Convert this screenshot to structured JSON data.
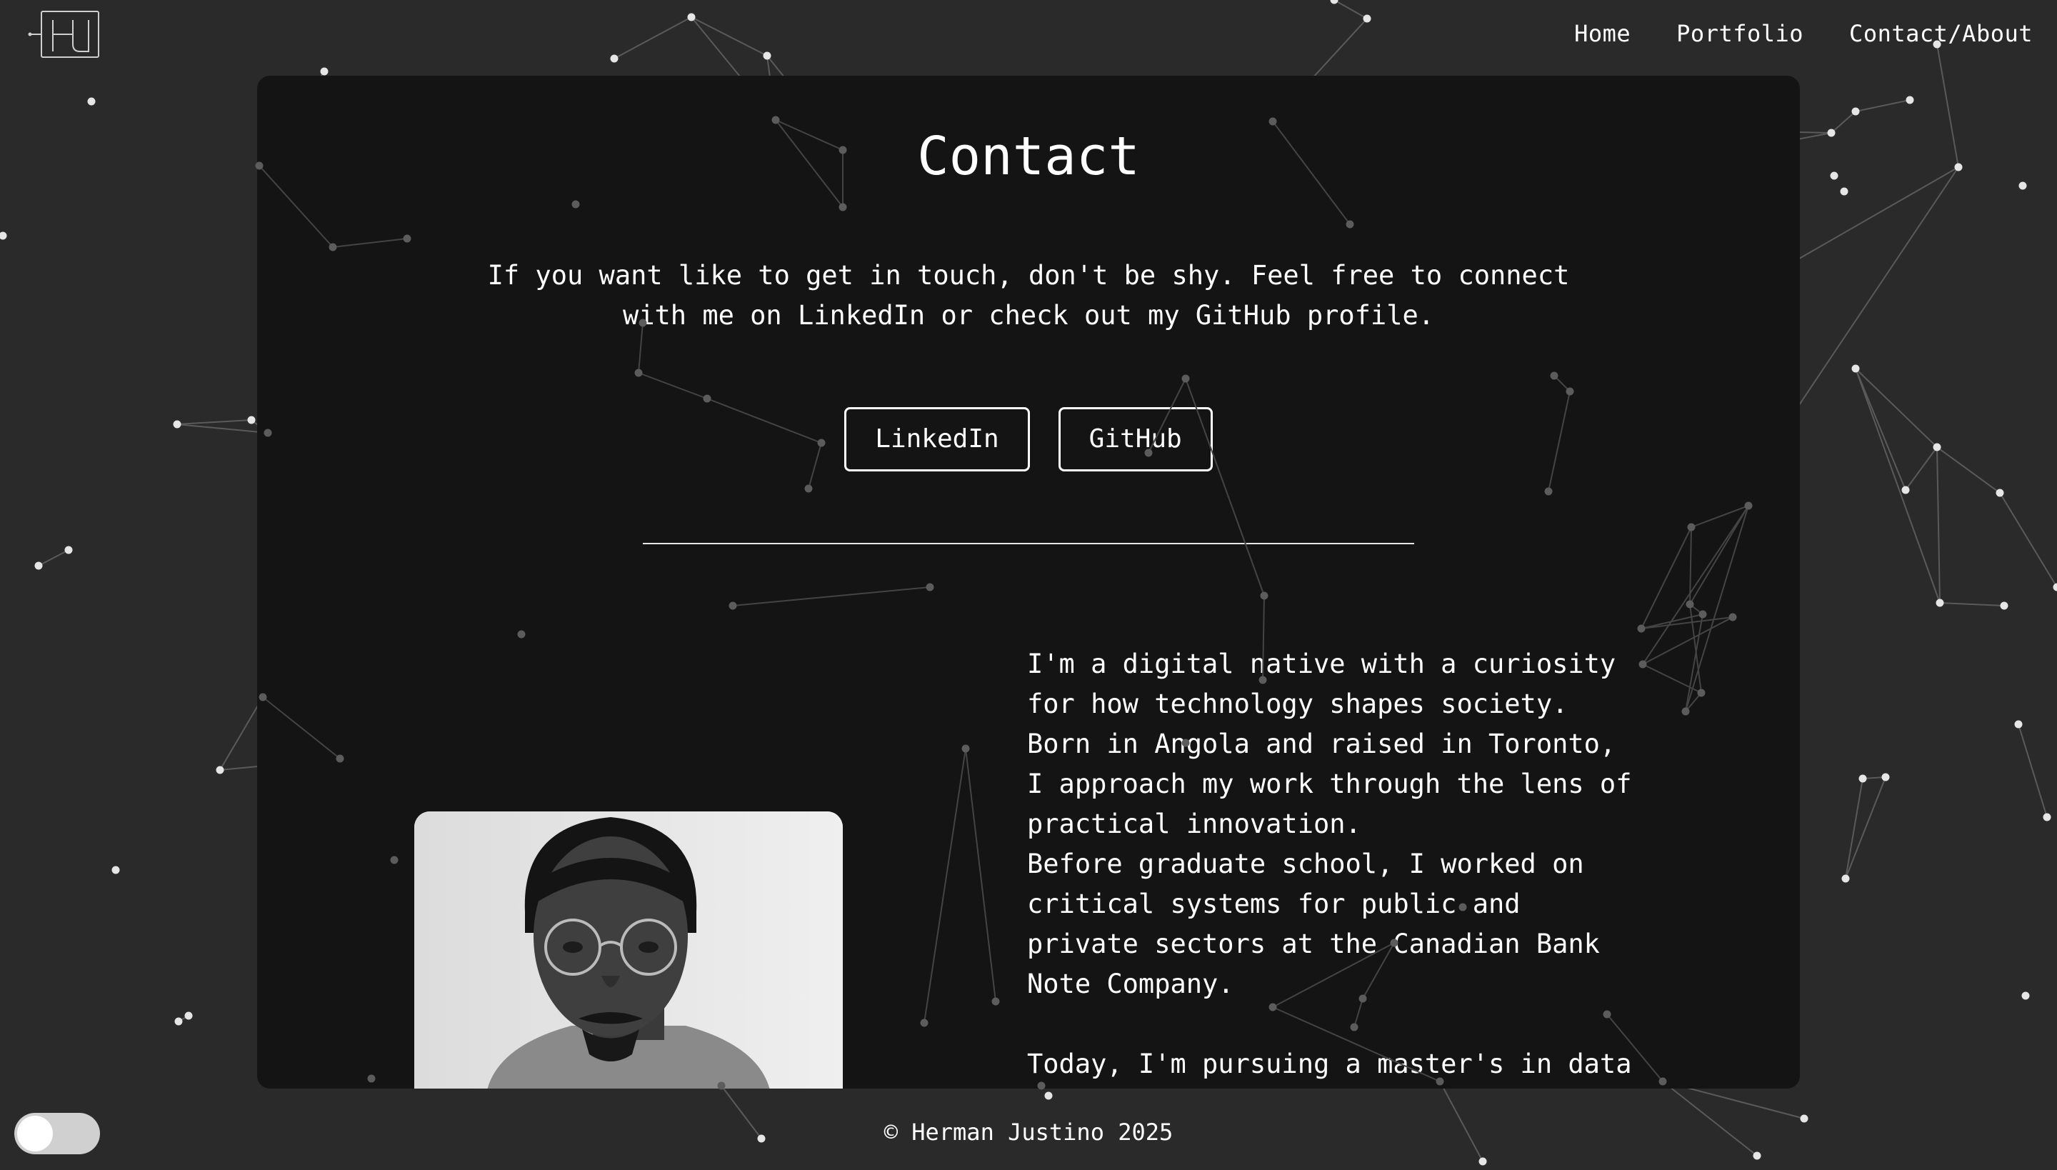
{
  "logo": {
    "alt": "HJ logo"
  },
  "nav": {
    "items": [
      "Home",
      "Portfolio",
      "Contact/About"
    ]
  },
  "contact": {
    "title": "Contact",
    "intro": "If you want like to get in touch, don't be shy. Feel free to connect with me on LinkedIn or check out my GitHub profile.",
    "buttons": {
      "linkedin": "LinkedIn",
      "github": "GitHub"
    }
  },
  "about": {
    "paragraph1": "I'm a digital native with a curiosity for how technology shapes society. Born in Angola and raised in Toronto, I approach my work through the lens of practical innovation.\nBefore graduate school, I worked on critical systems for public and private sectors at the Canadian Bank Note Company.",
    "paragraph2": "Today, I'm pursuing a master's in data"
  },
  "footer": {
    "text": "© Herman Justino 2025"
  },
  "theme_toggle": {
    "state": "off"
  },
  "colors": {
    "background": "#2a2a2a",
    "panel": "#141414",
    "text": "#ffffff",
    "network": "#8a8a8a"
  }
}
